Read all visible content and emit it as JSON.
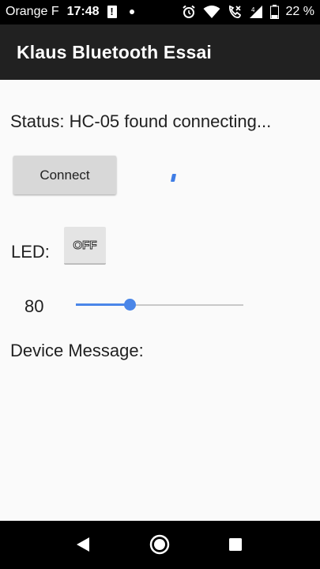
{
  "statusbar": {
    "carrier": "Orange F",
    "time": "17:48",
    "battery_percent": "22 %",
    "icons": [
      "alert-icon",
      "notification-dot-icon",
      "alarm-icon",
      "wifi-icon",
      "call-icon",
      "signal-icon",
      "battery-icon"
    ]
  },
  "appbar": {
    "title": "Klaus Bluetooth Essai"
  },
  "main": {
    "status_text": "Status: HC-05 found connecting...",
    "connect_label": "Connect",
    "led_label": "LED:",
    "led_toggle_label": "OFF",
    "slider_value_text": "80",
    "slider_level": 0.32,
    "device_message_label": "Device Message:"
  },
  "colors": {
    "accent": "#4a86e8",
    "appbar_bg": "#212121",
    "content_bg": "#fafafa",
    "button_bg": "#d8d8d8"
  },
  "navbar": {
    "icons": [
      "back-icon",
      "home-icon",
      "recents-icon"
    ]
  }
}
